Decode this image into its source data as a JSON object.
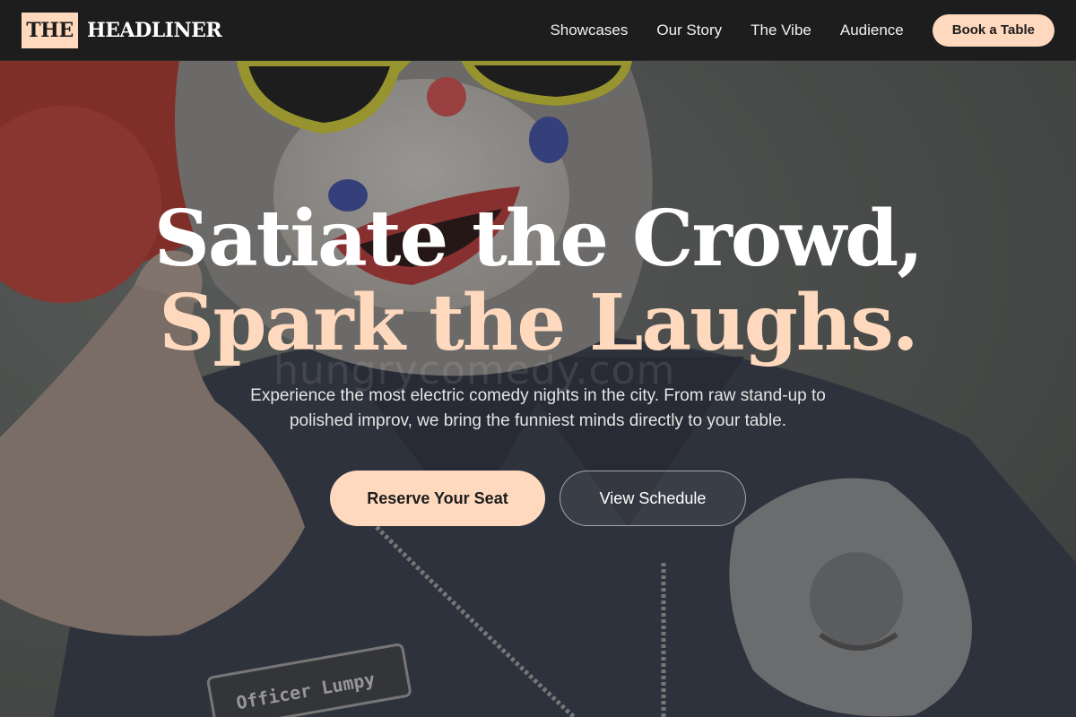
{
  "brand": {
    "logo_box": "THE",
    "logo_text": "HEADLINER",
    "accent_color": "#ffd9bd"
  },
  "nav": {
    "links": [
      {
        "label": "Showcases"
      },
      {
        "label": "Our Story"
      },
      {
        "label": "The Vibe"
      },
      {
        "label": "Audience"
      }
    ],
    "cta_label": "Book a Table"
  },
  "hero": {
    "headline_line1": "Satiate the Crowd,",
    "headline_line2": "Spark the Laughs.",
    "subtext": "Experience the most electric comedy nights in the city. From raw stand-up to polished improv, we bring the funniest minds directly to your table.",
    "primary_button": "Reserve Your Seat",
    "secondary_button": "View Schedule",
    "background_image": {
      "name_tag_text": "Officer Lumpy",
      "watermark_text": "hungrycomedy.com"
    }
  }
}
